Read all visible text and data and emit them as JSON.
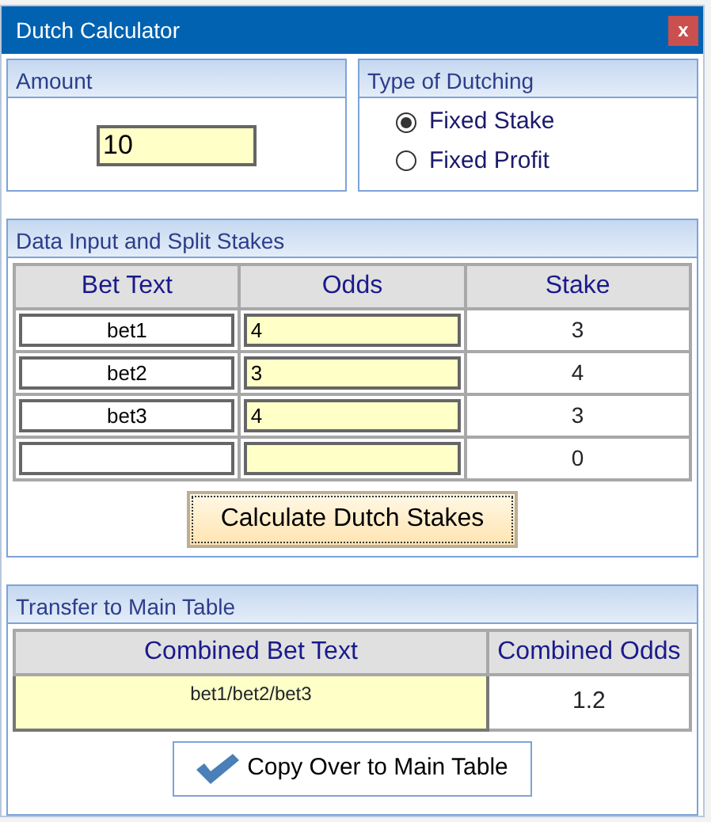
{
  "window": {
    "title": "Dutch Calculator",
    "close": "x"
  },
  "amount": {
    "title": "Amount",
    "value": "10"
  },
  "dutching": {
    "title": "Type of Dutching",
    "options": [
      {
        "label": "Fixed Stake",
        "selected": true
      },
      {
        "label": "Fixed Profit",
        "selected": false
      }
    ]
  },
  "data_input": {
    "title": "Data Input and Split Stakes",
    "columns": [
      "Bet Text",
      "Odds",
      "Stake"
    ],
    "rows": [
      {
        "bet_text": "bet1",
        "odds": "4",
        "stake": "3"
      },
      {
        "bet_text": "bet2",
        "odds": "3",
        "stake": "4"
      },
      {
        "bet_text": "bet3",
        "odds": "4",
        "stake": "3"
      },
      {
        "stake": "0"
      }
    ],
    "button": "Calculate Dutch Stakes"
  },
  "transfer": {
    "title": "Transfer to Main Table",
    "columns": [
      "Combined Bet Text",
      "Combined Odds"
    ],
    "combined_bet_text": "bet1/bet2/bet3",
    "combined_odds": "1.2",
    "button": "Copy Over to Main Table"
  }
}
